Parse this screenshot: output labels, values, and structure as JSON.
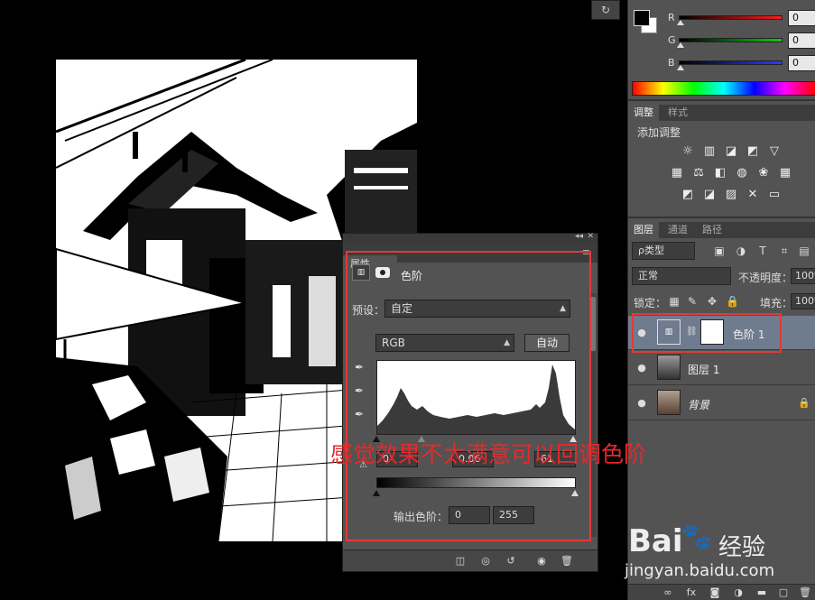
{
  "mini_tool_glyph": "↻",
  "color": {
    "channels": [
      {
        "label": "R",
        "value": "0",
        "color": "#ff1a1a"
      },
      {
        "label": "G",
        "value": "0",
        "color": "#19c419"
      },
      {
        "label": "B",
        "value": "0",
        "color": "#2b3bff"
      }
    ]
  },
  "adjustments": {
    "tabs": [
      "调整",
      "样式"
    ],
    "title": "添加调整",
    "rows": [
      [
        "☼",
        "▥",
        "◪",
        "◩",
        "▽"
      ],
      [
        "▦",
        "⚖",
        "◧",
        "◍",
        "❀",
        "▦"
      ],
      [
        "◩",
        "◪",
        "▨",
        "✕",
        "▭"
      ]
    ]
  },
  "layers": {
    "tabs": [
      "图层",
      "通道",
      "路径"
    ],
    "filter_kind": "ρ类型",
    "blend_mode": "正常",
    "opacity_label": "不透明度：",
    "opacity_value": "100%",
    "lock_label": "锁定：",
    "fill_label": "填充：",
    "fill_value": "100%",
    "items": [
      {
        "name": "色阶 1",
        "selected": true
      },
      {
        "name": "图层 1",
        "selected": false
      },
      {
        "name": "背景",
        "selected": false,
        "locked": true
      }
    ]
  },
  "properties": {
    "tab": "属性",
    "title": "色阶",
    "preset_label": "预设：",
    "preset_value": "自定",
    "channel_value": "RGB",
    "auto_label": "自动",
    "input_black": "0",
    "input_gamma": "0.06",
    "input_white": "61",
    "output_label": "输出色阶：",
    "output_black": "0",
    "output_white": "255"
  },
  "annotation": "感觉效果不太满意可以回调色阶",
  "watermark": {
    "logo": "Bai",
    "brand": "经验",
    "url": "jingyan.baidu.com"
  }
}
